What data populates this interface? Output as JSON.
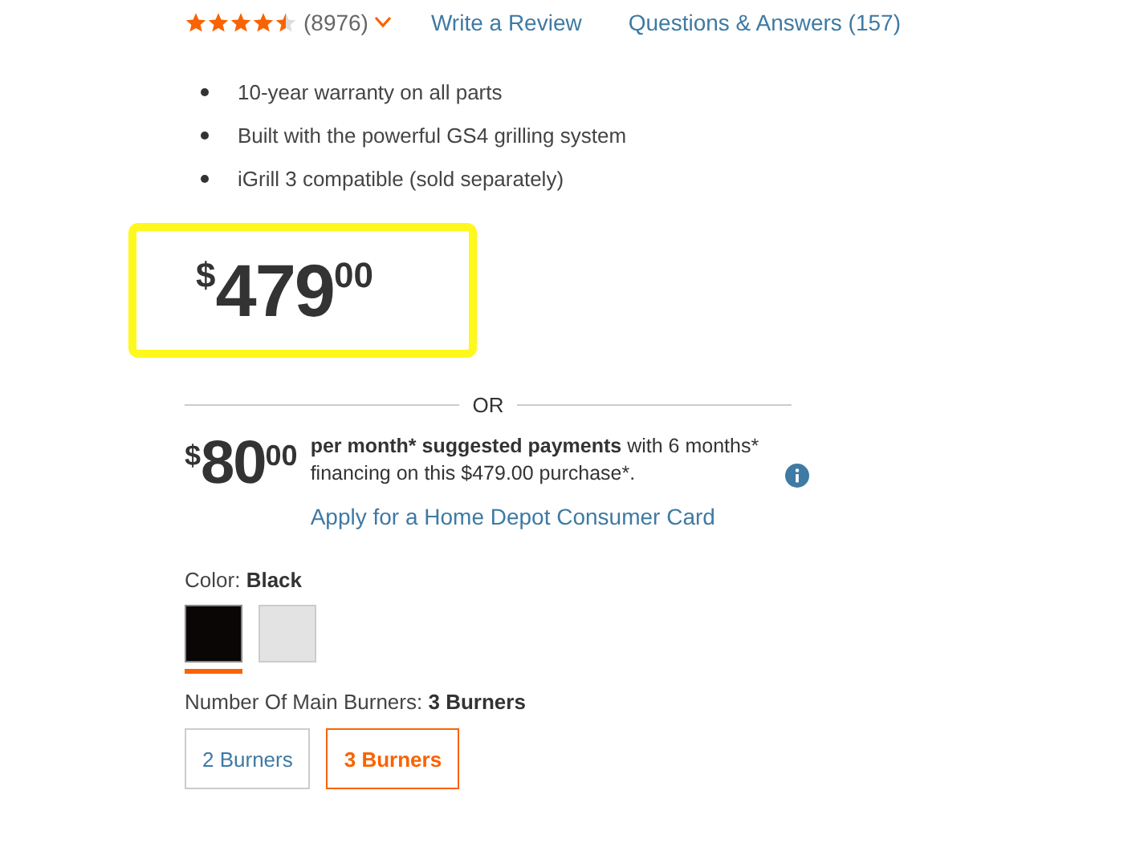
{
  "rating": {
    "stars": 4.5,
    "count": "(8976)",
    "links": [
      "Write a Review",
      "Questions & Answers (157)"
    ]
  },
  "features": [
    "10-year warranty on all parts",
    "Built with the powerful GS4 grilling system",
    "iGrill 3 compatible (sold separately)"
  ],
  "price": {
    "currency": "$",
    "whole": "479",
    "cents": "00",
    "highlighted": true
  },
  "divider_label": "OR",
  "financing": {
    "currency": "$",
    "whole": "80",
    "cents": "00",
    "text": "**per month* suggested payments** with 6 months* financing on this $479.00 purchase*.",
    "link": "Apply for a Home Depot Consumer Card"
  },
  "color": {
    "label": "Color:",
    "value": "Black",
    "swatches": [
      {
        "color": "#0a0606",
        "selected": true
      },
      {
        "color": "#e3e3e3",
        "selected": false
      }
    ]
  },
  "burners": {
    "label": "Number Of Main Burners:",
    "value": "3 Burners",
    "options": [
      {
        "label": "2 Burners",
        "selected": false
      },
      {
        "label": "3 Burners",
        "selected": true
      }
    ]
  }
}
